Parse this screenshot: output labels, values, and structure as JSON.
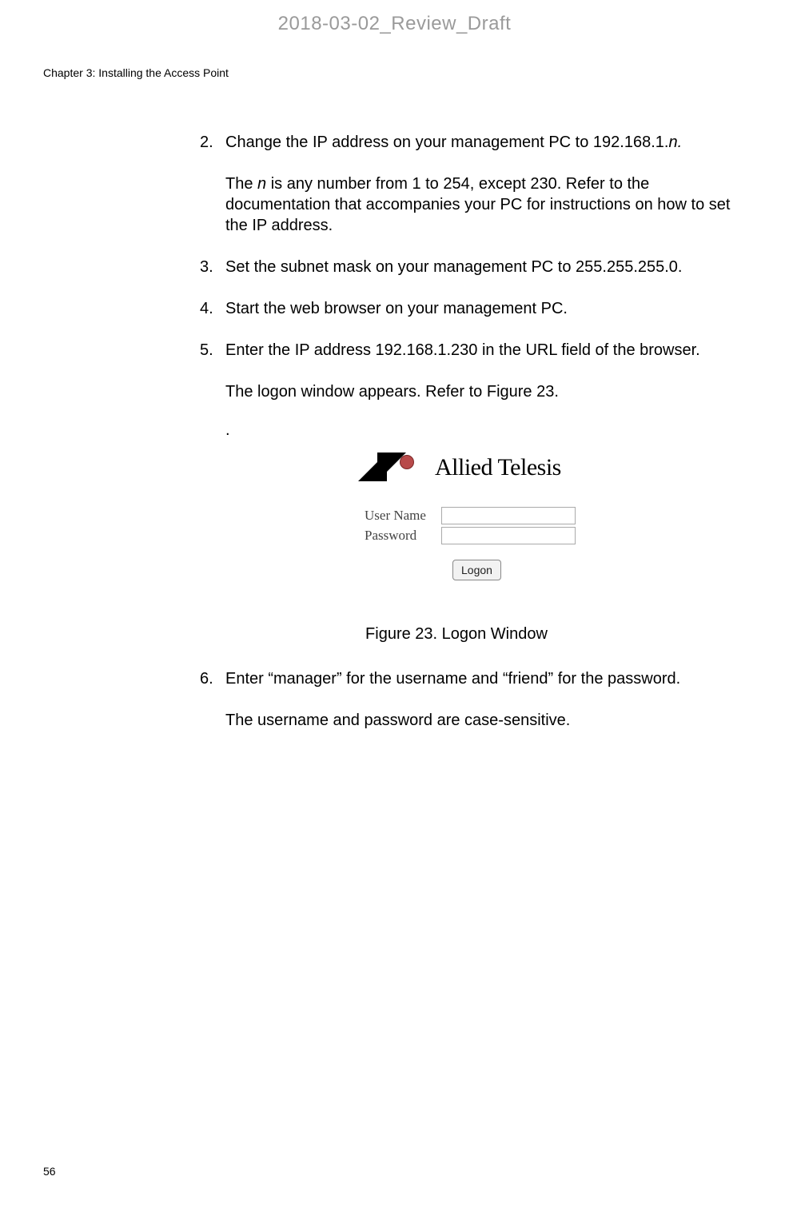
{
  "watermark": "2018-03-02_Review_Draft",
  "chapter_header": "Chapter 3: Installing the Access Point",
  "page_number": "56",
  "steps": {
    "s2": {
      "marker": "2.",
      "text_before": "Change the IP address on your management PC to 192.168.1.",
      "text_italic": "n.",
      "sub_before": "The ",
      "sub_italic": "n",
      "sub_after": " is any number from 1 to 254, except 230. Refer to the documentation that accompanies your PC for instructions on how to set the IP address."
    },
    "s3": {
      "marker": "3.",
      "text": "Set the subnet mask on your management PC to 255.255.255.0."
    },
    "s4": {
      "marker": "4.",
      "text": "Start the web browser on your management PC."
    },
    "s5": {
      "marker": "5.",
      "text": "Enter the IP address 192.168.1.230 in the URL field of the browser.",
      "sub": "The logon window appears. Refer to Figure 23.",
      "dot": "."
    },
    "s6": {
      "marker": "6.",
      "text": "Enter “manager” for the username and “friend” for the password.",
      "sub": "The username and password are case-sensitive."
    }
  },
  "figure": {
    "logo_text": "Allied Telesis",
    "username_label": "User Name",
    "password_label": "Password",
    "logon_button": "Logon",
    "caption": "Figure 23. Logon Window"
  }
}
